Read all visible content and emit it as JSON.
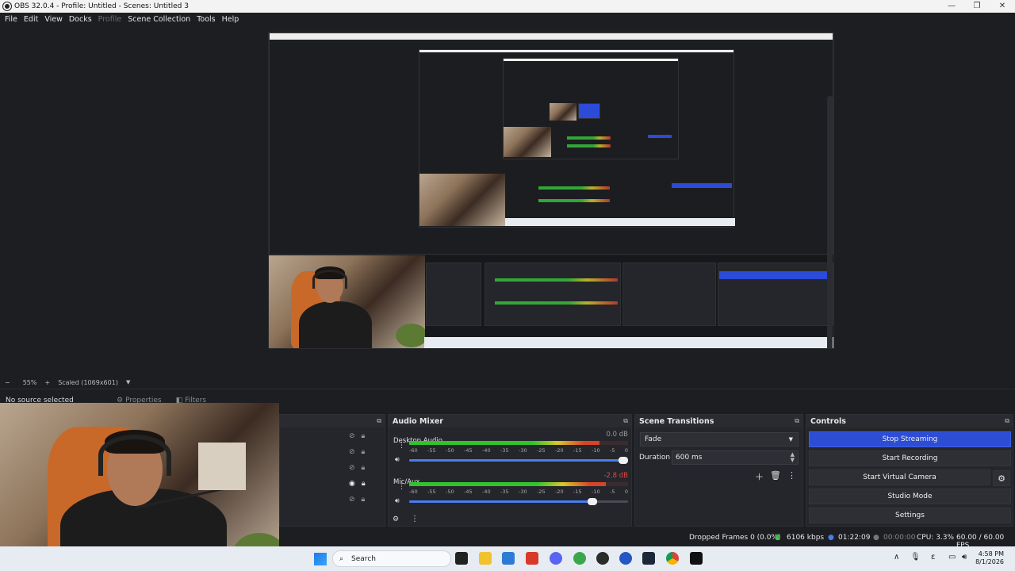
{
  "window": {
    "title": "OBS 32.0.4 - Profile: Untitled - Scenes: Untitled 3"
  },
  "menu": {
    "items": [
      "File",
      "Edit",
      "View",
      "Docks",
      "Profile",
      "Scene Collection",
      "Tools",
      "Help"
    ]
  },
  "preview": {
    "zoom": "55%",
    "scale_mode": "Scaled (1069x601)",
    "minus": "−",
    "plus": "+"
  },
  "source_toolbar": {
    "no_source": "No source selected",
    "properties": "Properties",
    "filters": "Filters"
  },
  "audio_mixer": {
    "title": "Audio Mixer",
    "scale": [
      "-60",
      "-55",
      "-50",
      "-45",
      "-40",
      "-35",
      "-30",
      "-25",
      "-20",
      "-15",
      "-10",
      "-5",
      "0"
    ],
    "channels": [
      {
        "name": "Desktop Audio",
        "db": "0.0 dB",
        "level": 0.87,
        "volume": 1.0
      },
      {
        "name": "Mic/Aux",
        "db": "-2.8 dB",
        "level": 0.9,
        "volume": 0.86
      }
    ]
  },
  "transitions": {
    "title": "Scene Transitions",
    "selected": "Fade",
    "duration_label": "Duration",
    "duration": "600 ms"
  },
  "controls": {
    "title": "Controls",
    "stop_streaming": "Stop Streaming",
    "start_recording": "Start Recording",
    "start_virtual_camera": "Start Virtual Camera",
    "studio_mode": "Studio Mode",
    "settings": "Settings"
  },
  "status": {
    "dropped_frames": "Dropped Frames 0 (0.0%)",
    "bitrate": "6106 kbps",
    "stream_time": "01:22:09",
    "rec_time": "00:00:00",
    "cpu": "CPU: 3.3%",
    "fps": "60.00 / 60.00 FPS"
  },
  "taskbar": {
    "search": "Search",
    "time": "4:58 PM",
    "date": "8/1/2026"
  },
  "colors": {
    "accent": "#2d4dd4",
    "meter_green": "#31c32e",
    "meter_yellow": "#d8c92a",
    "meter_red": "#d84428"
  }
}
